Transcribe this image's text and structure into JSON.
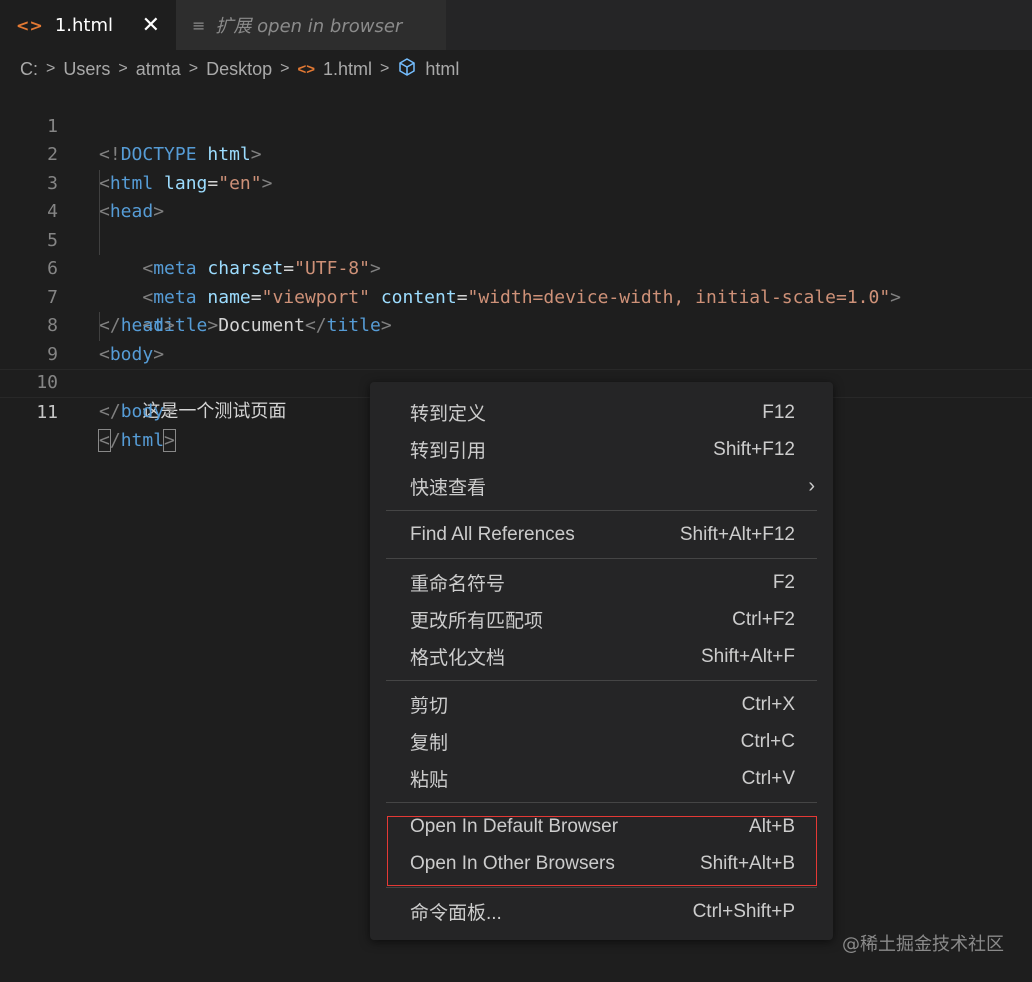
{
  "tabs": [
    {
      "label": "1.html",
      "close": "✕"
    },
    {
      "label": "扩展 open in browser"
    }
  ],
  "breadcrumb": [
    "C:",
    "Users",
    "atmta",
    "Desktop",
    "1.html",
    "html"
  ],
  "editor": {
    "line_numbers": [
      "1",
      "2",
      "3",
      "4",
      "5",
      "6",
      "7",
      "8",
      "9",
      "10",
      "11"
    ],
    "text_line9": "这是一个测试页面",
    "title_text": "Document"
  },
  "context_menu": {
    "items": [
      {
        "label": "转到定义",
        "shortcut": "F12"
      },
      {
        "label": "转到引用",
        "shortcut": "Shift+F12"
      },
      {
        "label": "快速查看",
        "shortcut": ""
      },
      {
        "label": "Find All References",
        "shortcut": "Shift+Alt+F12"
      },
      {
        "label": "重命名符号",
        "shortcut": "F2"
      },
      {
        "label": "更改所有匹配项",
        "shortcut": "Ctrl+F2"
      },
      {
        "label": "格式化文档",
        "shortcut": "Shift+Alt+F"
      },
      {
        "label": "剪切",
        "shortcut": "Ctrl+X"
      },
      {
        "label": "复制",
        "shortcut": "Ctrl+C"
      },
      {
        "label": "粘贴",
        "shortcut": "Ctrl+V"
      },
      {
        "label": "Open In Default Browser",
        "shortcut": "Alt+B"
      },
      {
        "label": "Open In Other Browsers",
        "shortcut": "Shift+Alt+B"
      },
      {
        "label": "命令面板...",
        "shortcut": "Ctrl+Shift+P"
      }
    ],
    "highlight_color": "#e53935"
  },
  "watermark": "@稀土掘金技术社区"
}
